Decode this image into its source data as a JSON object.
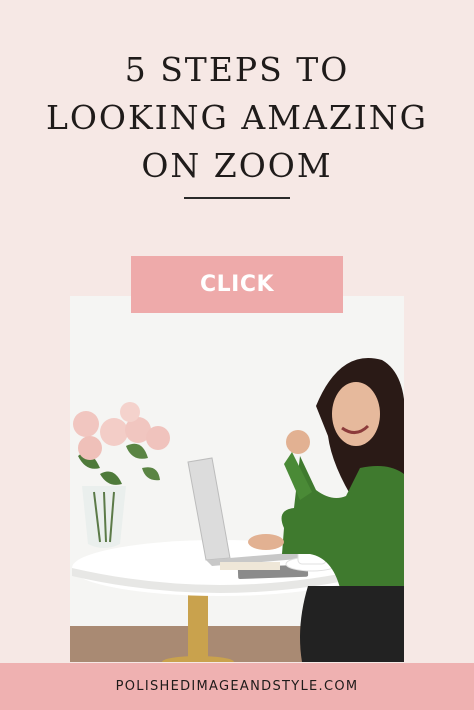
{
  "headline": {
    "line1": "5 STEPS TO",
    "line2": "LOOKING AMAZING",
    "line3": "ON ZOOM"
  },
  "cta": {
    "label": "CLICK"
  },
  "footer": {
    "site": "POLISHEDIMAGEANDSTYLE.COM"
  },
  "colors": {
    "background": "#f6e8e5",
    "accent_pink": "#eeaaaa",
    "footer_pink": "#efb1b1",
    "text_dark": "#1f1b1a"
  },
  "photo": {
    "icon": "woman-at-laptop-photo"
  }
}
